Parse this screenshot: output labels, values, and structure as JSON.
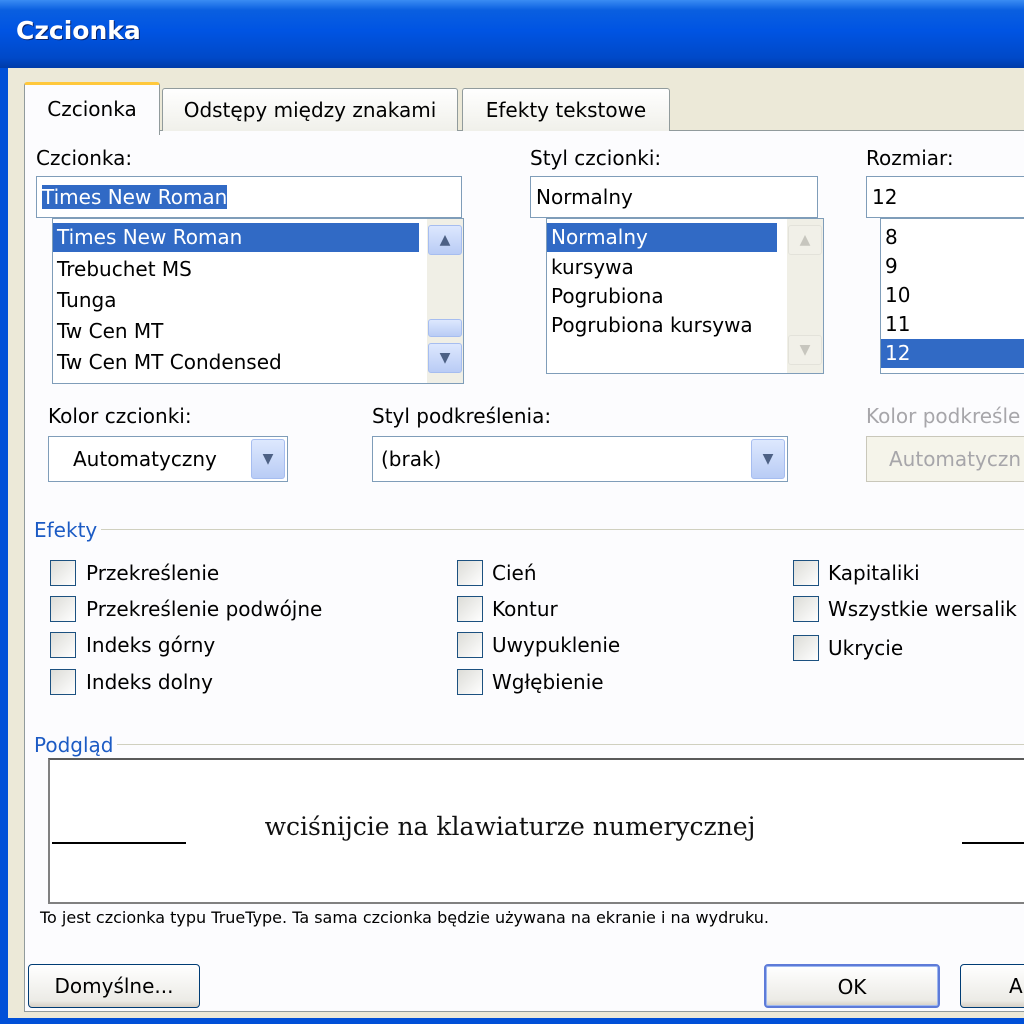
{
  "window": {
    "title": "Czcionka"
  },
  "tabs": [
    {
      "label": "Czcionka"
    },
    {
      "label": "Odstępy między znakami"
    },
    {
      "label": "Efekty tekstowe"
    }
  ],
  "font": {
    "label": "Czcionka:",
    "value": "Times New Roman",
    "items": [
      "Times New Roman",
      "Trebuchet MS",
      "Tunga",
      "Tw Cen MT",
      "Tw Cen MT Condensed"
    ],
    "selected": "Times New Roman"
  },
  "style": {
    "label": "Styl czcionki:",
    "value": "Normalny",
    "items": [
      "Normalny",
      "kursywa",
      "Pogrubiona",
      "Pogrubiona kursywa"
    ],
    "selected": "Normalny"
  },
  "size": {
    "label": "Rozmiar:",
    "value": "12",
    "items": [
      "8",
      "9",
      "10",
      "11",
      "12"
    ],
    "selected": "12"
  },
  "font_color": {
    "label": "Kolor czcionki:",
    "value": "Automatyczny"
  },
  "underline_style": {
    "label": "Styl podkreślenia:",
    "value": "(brak)"
  },
  "underline_color": {
    "label": "Kolor podkreśle",
    "value": "Automatyczn"
  },
  "effects": {
    "title": "Efekty",
    "col1": [
      "Przekreślenie",
      "Przekreślenie podwójne",
      "Indeks górny",
      "Indeks dolny"
    ],
    "col2": [
      "Cień",
      "Kontur",
      "Uwypuklenie",
      "Wgłębienie"
    ],
    "col3": [
      "Kapitaliki",
      "Wszystkie wersalik",
      "Ukrycie"
    ]
  },
  "preview": {
    "title": "Podgląd",
    "sample": "wciśnijcie na klawiaturze numerycznej",
    "note": "To jest czcionka typu TrueType. Ta sama czcionka będzie używana na ekranie i na wydruku."
  },
  "buttons": {
    "default": "Domyślne...",
    "ok": "OK",
    "cancel_partial": "A"
  },
  "colors": {
    "titlebar": "#0054e3",
    "selection": "#316ac5",
    "group_title": "#1c5bc4",
    "tab_highlight": "#ffc83c"
  },
  "icons": {
    "scroll_up": "chevron-up-icon",
    "scroll_down": "chevron-down-icon",
    "dropdown": "chevron-down-icon"
  }
}
